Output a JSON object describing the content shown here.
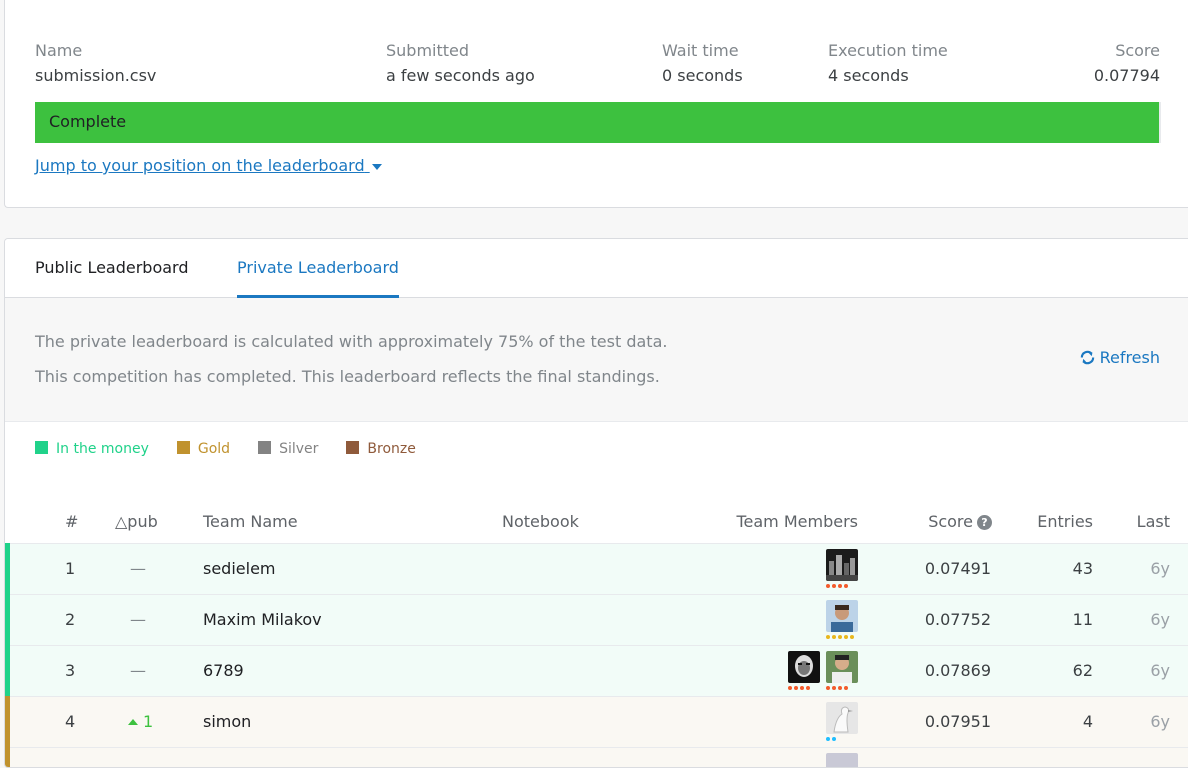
{
  "submission": {
    "name_label": "Name",
    "name_value": "submission.csv",
    "submitted_label": "Submitted",
    "submitted_value": "a few seconds ago",
    "wait_label": "Wait time",
    "wait_value": "0 seconds",
    "exec_label": "Execution time",
    "exec_value": "4 seconds",
    "score_label": "Score",
    "score_value": "0.07794",
    "status": "Complete",
    "jump_link": "Jump to your position on the leaderboard"
  },
  "tabs": {
    "public": "Public Leaderboard",
    "private": "Private Leaderboard"
  },
  "info": {
    "line1": "The private leaderboard is calculated with approximately 75% of the test data.",
    "line2": "This competition has completed. This leaderboard reflects the final standings.",
    "refresh": "Refresh"
  },
  "legend": [
    {
      "label": "In the money",
      "color": "#20d28a"
    },
    {
      "label": "Gold",
      "color": "#c0922e"
    },
    {
      "label": "Silver",
      "color": "#838383"
    },
    {
      "label": "Bronze",
      "color": "#8f5a3b"
    }
  ],
  "columns": {
    "rank": "#",
    "delta": "△pub",
    "team": "Team Name",
    "notebook": "Notebook",
    "members": "Team Members",
    "score": "Score",
    "entries": "Entries",
    "last": "Last"
  },
  "rows": [
    {
      "rank": "1",
      "delta": "—",
      "team": "sedielem",
      "score": "0.07491",
      "entries": "43",
      "last": "6y",
      "marker": "#20d28a",
      "bg": "#f2fcf8",
      "members": [
        {
          "pic": "dark-city-avatar",
          "dots": [
            "#f35b2c",
            "#f35b2c",
            "#f35b2c",
            "#f35b2c"
          ]
        }
      ]
    },
    {
      "rank": "2",
      "delta": "—",
      "team": "Maxim Milakov",
      "score": "0.07752",
      "entries": "11",
      "last": "6y",
      "marker": "#20d28a",
      "bg": "#f2fcf8",
      "members": [
        {
          "pic": "man-portrait-avatar",
          "dots": [
            "#e8b71e",
            "#e8b71e",
            "#e8b71e",
            "#e8b71e",
            "#e8b71e"
          ]
        }
      ]
    },
    {
      "rank": "3",
      "delta": "—",
      "team": "6789",
      "score": "0.07869",
      "entries": "62",
      "last": "6y",
      "marker": "#20d28a",
      "bg": "#f2fcf8",
      "members": [
        {
          "pic": "bw-face-avatar",
          "dots": [
            "#f35b2c",
            "#f35b2c",
            "#f35b2c",
            "#f35b2c"
          ]
        },
        {
          "pic": "outdoor-man-avatar",
          "dots": [
            "#f35b2c",
            "#f35b2c",
            "#f35b2c",
            "#f35b2c"
          ]
        }
      ]
    },
    {
      "rank": "4",
      "delta": "1",
      "delta_up": true,
      "team": "simon",
      "score": "0.07951",
      "entries": "4",
      "last": "6y",
      "marker": "#c0922e",
      "bg": "#faf8f3",
      "members": [
        {
          "pic": "bird-avatar",
          "dots": [
            "#20beff",
            "#20beff"
          ]
        }
      ]
    },
    {
      "rank": "",
      "delta": "",
      "team": "",
      "score": "",
      "entries": "",
      "last": "",
      "marker": "#c0922e",
      "bg": "#faf8f3",
      "members": [
        {
          "pic": "partial-avatar",
          "dots": []
        }
      ]
    }
  ]
}
